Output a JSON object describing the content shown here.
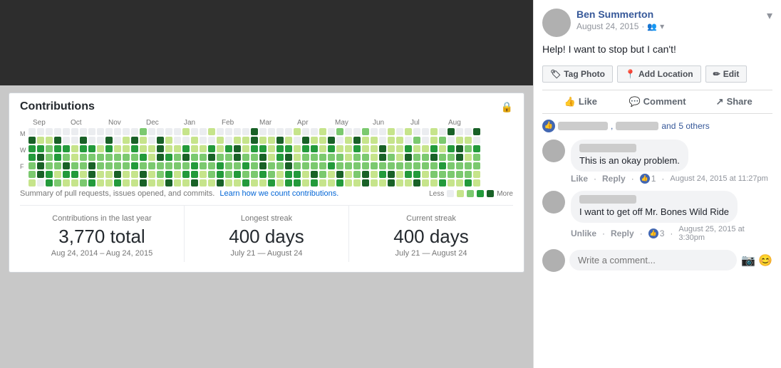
{
  "leftPanel": {
    "contributions": {
      "title": "Contributions",
      "summaryText": "Summary of pull requests, issues opened, and commits.",
      "learnMoreLink": "Learn how we count contributions.",
      "lessLabel": "Less",
      "moreLabel": "More",
      "months": [
        "Sep",
        "Oct",
        "Nov",
        "Dec",
        "Jan",
        "Feb",
        "Mar",
        "Apr",
        "May",
        "Jun",
        "Jul",
        "Aug"
      ],
      "dayLabels": [
        "M",
        "W",
        "F"
      ]
    },
    "stats": [
      {
        "label": "Contributions in the last year",
        "value": "3,770 total",
        "range": "Aug 24, 2014 – Aug 24, 2015"
      },
      {
        "label": "Longest streak",
        "value": "400 days",
        "range": "July 21 — August 24"
      },
      {
        "label": "Current streak",
        "value": "400 days",
        "range": "July 21 — August 24"
      }
    ]
  },
  "rightPanel": {
    "author": "Ben Summerton",
    "date": "August 24, 2015",
    "postContent": "Help! I want to stop but I can't!",
    "chevronLabel": "▾",
    "actionButtons": [
      {
        "label": "Tag Photo",
        "icon": "🏷"
      },
      {
        "label": "Add Location",
        "icon": "📍"
      },
      {
        "label": "Edit",
        "icon": "✏"
      }
    ],
    "reactions": {
      "andText": "and",
      "othersText": "5 others"
    },
    "fbButtons": [
      {
        "label": "Like",
        "icon": "👍"
      },
      {
        "label": "Comment",
        "icon": "💬"
      },
      {
        "label": "Share",
        "icon": "↗"
      }
    ],
    "comments": [
      {
        "text": "This is an okay problem.",
        "likeAction": "Like",
        "replyAction": "Reply",
        "likeCount": "1",
        "timestamp": "August 24, 2015 at 11:27pm"
      },
      {
        "text": "I want to get off Mr. Bones Wild Ride",
        "unlikeAction": "Unlike",
        "replyAction": "Reply",
        "likeCount": "3",
        "timestamp": "August 25, 2015 at 3:30pm"
      }
    ],
    "commentPlaceholder": "Write a comment...",
    "cameraIcon": "📷",
    "emojiIcon": "😊"
  }
}
